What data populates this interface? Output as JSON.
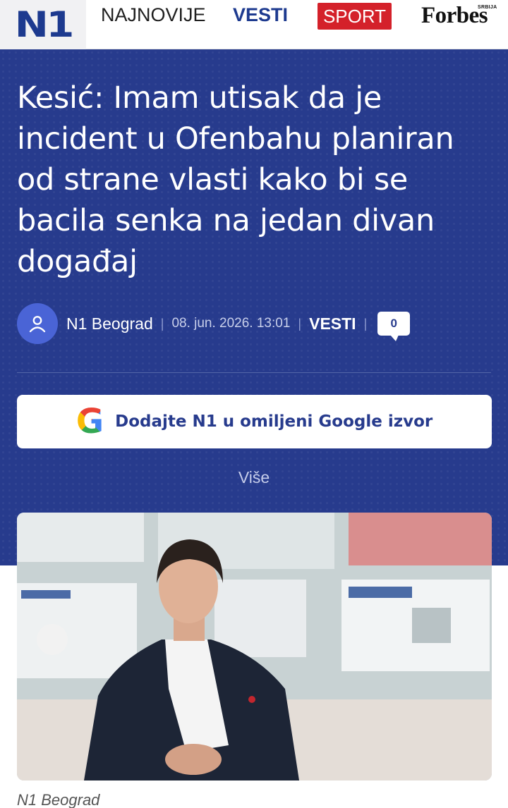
{
  "nav": {
    "logo": "N1",
    "items": [
      "NAJNOVIJE",
      "VESTI",
      "SPORT"
    ],
    "partner_logo": "Forbes",
    "partner_sub": "SRBIJA",
    "colors": {
      "brand": "#1d3a8f",
      "sport": "#d4212a"
    }
  },
  "article": {
    "title": "Kesić: Imam utisak da je incident u Ofenbahu planiran od strane vlasti kako bi se bacila senka na jedan divan događaj",
    "author": "N1 Beograd",
    "date": "08. jun. 2026. 13:01",
    "category": "VESTI",
    "comments": "0",
    "author_icon": "user-icon",
    "google_button_label": "Dodajte N1 u omiljeni Google izvor",
    "google_icon": "google-g-icon",
    "more_label": "Više",
    "photo_credit": "N1 Beograd",
    "colors": {
      "hero_bg": "#273b8d",
      "avatar": "#4a64d6"
    }
  }
}
